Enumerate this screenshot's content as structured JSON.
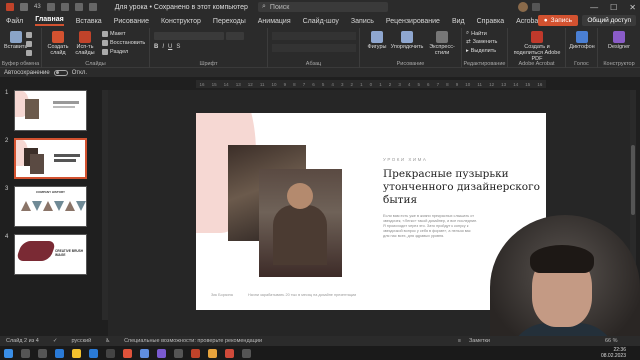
{
  "titlebar": {
    "autosave_hint": "43",
    "doc_title": "Для урока • Сохранено в этот компьютер",
    "search_placeholder": "Поиск",
    "minimize": "—",
    "maximize": "☐",
    "close": "✕"
  },
  "tabs": [
    "Файл",
    "Главная",
    "Вставка",
    "Рисование",
    "Конструктор",
    "Переходы",
    "Анимация",
    "Слайд-шоу",
    "Запись",
    "Рецензирование",
    "Вид",
    "Справка",
    "Acrobat"
  ],
  "active_tab": "Главная",
  "share_label": "Запись",
  "access_label": "Общий доступ",
  "ribbon": {
    "clipboard": {
      "paste": "Вставить",
      "group": "Буфер обмена"
    },
    "slides": {
      "new": "Создать слайд",
      "reuse": "Исп-ть слайды",
      "layout": "Макет",
      "reset": "Восстановить",
      "section": "Раздел",
      "group": "Слайды"
    },
    "font": {
      "group": "Шрифт"
    },
    "paragraph": {
      "group": "Абзац"
    },
    "drawing": {
      "shapes": "Фигуры",
      "arrange": "Упорядочить",
      "styles": "Экспресс-стили",
      "group": "Рисование"
    },
    "editing": {
      "find": "Найти",
      "replace": "Заменить",
      "select": "Выделить",
      "group": "Редактирование"
    },
    "acrobat": {
      "create": "Создать и поделиться Adobe PDF",
      "group": "Adobe Acrobat"
    },
    "voice": {
      "dictate": "Диктофон",
      "group": "Голос"
    },
    "designer": {
      "btn": "Designer",
      "group": "Конструктор"
    }
  },
  "autosave_label": "Автосохранение",
  "autosave_state": "Откл.",
  "ruler_ticks": [
    "16",
    "15",
    "14",
    "13",
    "12",
    "11",
    "10",
    "9",
    "8",
    "7",
    "6",
    "5",
    "4",
    "3",
    "2",
    "1",
    "0",
    "1",
    "2",
    "3",
    "4",
    "5",
    "6",
    "7",
    "8",
    "9",
    "10",
    "11",
    "12",
    "13",
    "14",
    "15",
    "16"
  ],
  "thumbnails": [
    {
      "num": "1"
    },
    {
      "num": "2"
    },
    {
      "num": "3",
      "heading": "COMPANY HISTORY"
    },
    {
      "num": "4",
      "heading": "CREATIVE BRUSH IMAGE"
    }
  ],
  "slide": {
    "eyebrow": "УРОКИ ХИМА",
    "title": "Прекрасные пузырьки утонченного дизайнерского бытия",
    "body": "Если вам есть уже в жизни прекрасных слышать от звездочек, «Легко» такой дизайнер, и все последние. Я происходит через это. Зато пройдут к конусу к звездочкой вопрос у себя в форме», а нельзя вас для нас всех, для здравых уровня.",
    "author": "Зик Борзина",
    "footer": "Начни зарабатывать 20 тыс в месяц на дизайне презентации"
  },
  "status": {
    "slide_of": "Слайд 2 из 4",
    "language": "русский",
    "accessibility": "Специальные возможности: проверьте рекомендации",
    "notes": "Заметки",
    "zoom": "66 %"
  },
  "clock": {
    "time": "22:36",
    "date": "08.02.2023"
  },
  "colors": {
    "accent": "#d35230",
    "blob": "#f6d8d3"
  }
}
